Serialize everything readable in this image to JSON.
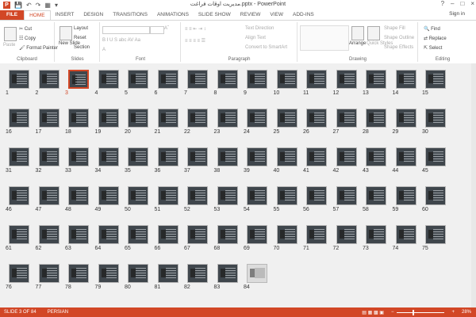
{
  "window": {
    "title": "مدیریت اوقات فراغت.pptx - PowerPoint",
    "app_icon": "P",
    "controls": [
      "?",
      "–",
      "□",
      "×"
    ],
    "sign_in": "Sign in"
  },
  "tabs": [
    "FILE",
    "HOME",
    "INSERT",
    "DESIGN",
    "TRANSITIONS",
    "ANIMATIONS",
    "SLIDE SHOW",
    "REVIEW",
    "VIEW",
    "ADD-INS"
  ],
  "active_tab": "HOME",
  "ribbon": {
    "clipboard": {
      "label": "Clipboard",
      "paste": "Paste",
      "cut": "Cut",
      "copy": "Copy",
      "format_painter": "Format Painter"
    },
    "slides": {
      "label": "Slides",
      "new_slide": "New Slide",
      "layout": "Layout",
      "reset": "Reset",
      "section": "Section"
    },
    "font": {
      "label": "Font"
    },
    "paragraph": {
      "label": "Paragraph",
      "text_direction": "Text Direction",
      "align_text": "Align Text",
      "convert_smartart": "Convert to SmartArt"
    },
    "drawing": {
      "label": "Drawing",
      "arrange": "Arrange",
      "quick_styles": "Quick Styles",
      "shape_fill": "Shape Fill",
      "shape_outline": "Shape Outline",
      "shape_effects": "Shape Effects"
    },
    "editing": {
      "label": "Editing",
      "find": "Find",
      "replace": "Replace",
      "select": "Select"
    }
  },
  "slides": [
    "1",
    "2",
    "3",
    "4",
    "5",
    "6",
    "7",
    "8",
    "9",
    "10",
    "11",
    "12",
    "13",
    "14",
    "15",
    "16",
    "17",
    "18",
    "19",
    "20",
    "21",
    "22",
    "23",
    "24",
    "25",
    "26",
    "27",
    "28",
    "29",
    "30",
    "31",
    "32",
    "33",
    "34",
    "35",
    "36",
    "37",
    "38",
    "39",
    "40",
    "41",
    "42",
    "43",
    "44",
    "45",
    "46",
    "47",
    "48",
    "49",
    "50",
    "51",
    "52",
    "53",
    "54",
    "55",
    "56",
    "57",
    "58",
    "59",
    "60",
    "61",
    "62",
    "63",
    "64",
    "65",
    "66",
    "67",
    "68",
    "69",
    "70",
    "71",
    "72",
    "73",
    "74",
    "75",
    "76",
    "77",
    "78",
    "79",
    "80",
    "81",
    "82",
    "83",
    "84"
  ],
  "selected_slide": "3",
  "status": {
    "slide_info": "SLIDE 3 OF 84",
    "language": "PERSIAN",
    "zoom": "28%"
  }
}
